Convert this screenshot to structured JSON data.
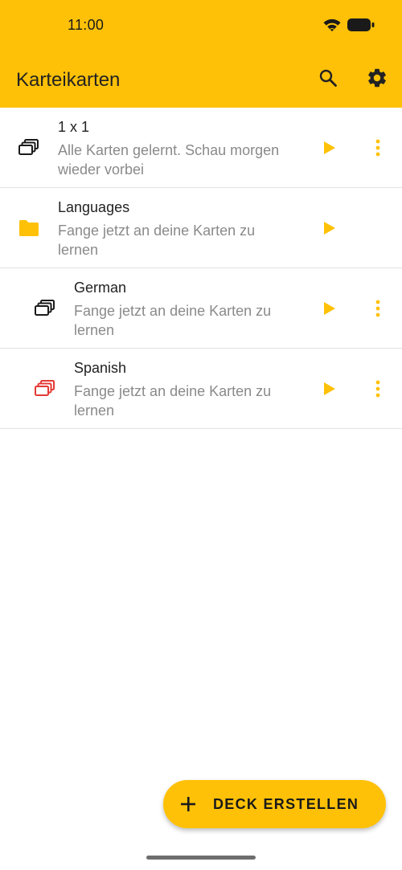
{
  "status_bar": {
    "time": "11:00"
  },
  "app_bar": {
    "title": "Karteikarten",
    "icons": {
      "search": "search-icon",
      "settings": "gear-icon"
    }
  },
  "items": [
    {
      "title": "1 x 1",
      "subtitle": "Alle Karten gelernt. Schau morgen wieder vorbei",
      "icon": "cards-icon",
      "level": 0
    },
    {
      "title": "Languages",
      "subtitle": "Fange jetzt an deine Karten zu lernen",
      "icon": "folder-icon",
      "level": 0
    },
    {
      "title": "German",
      "subtitle": "Fange jetzt an deine Karten zu lernen",
      "icon": "cards-icon",
      "level": 1
    },
    {
      "title": "Spanish",
      "subtitle": "Fange jetzt an deine Karten zu lernen",
      "icon": "cards-icon",
      "level": 1
    }
  ],
  "fab": {
    "label": "DECK ERSTELLEN",
    "icon": "plus-icon"
  },
  "colors": {
    "primary": "#FFC107",
    "accent_red": "#E53935",
    "text": "#222222",
    "subtext": "#8a8a8a",
    "divider": "#e2e2e2"
  }
}
